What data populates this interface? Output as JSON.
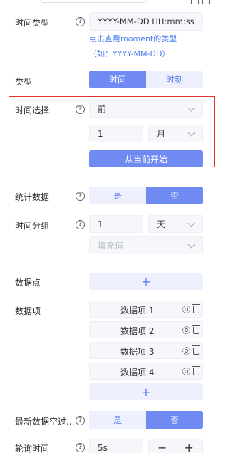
{
  "time_type": {
    "label": "时间类型",
    "input_placeholder": "YYYY-MM-DD HH:mm:ss",
    "hint_link": "点击查看moment的类型",
    "hint_example": "（如：YYYY-MM-DD）"
  },
  "type": {
    "label": "类型",
    "options": [
      "时间",
      "时刻"
    ],
    "selected": "时间"
  },
  "time_select": {
    "label": "时间选择",
    "direction_value": "前",
    "amount_value": "1",
    "unit_value": "月",
    "start_button": "从当前开始"
  },
  "stats": {
    "label": "统计数据",
    "options": [
      "是",
      "否"
    ],
    "selected": "否"
  },
  "time_group": {
    "label": "时间分组",
    "amount_value": "1",
    "unit_value": "天",
    "fill_placeholder": "填充值"
  },
  "data_points": {
    "label": "数据点",
    "add_symbol": "+"
  },
  "data_items": {
    "label": "数据项",
    "items": [
      "数据项 1",
      "数据项 2",
      "数据项 3",
      "数据项 4"
    ],
    "add_symbol": "+"
  },
  "latest_empty": {
    "label": "最新数据空过...",
    "options": [
      "是",
      "否"
    ],
    "selected": "否"
  },
  "polling": {
    "label": "轮询时间",
    "value": "5s",
    "minus_symbol": "−",
    "plus_symbol": "+"
  },
  "help_symbol": "?",
  "colors": {
    "primary": "#6f8bf3",
    "primary_light": "#eef1fd",
    "link": "#4a7df0",
    "highlight_border": "#e0322f"
  }
}
